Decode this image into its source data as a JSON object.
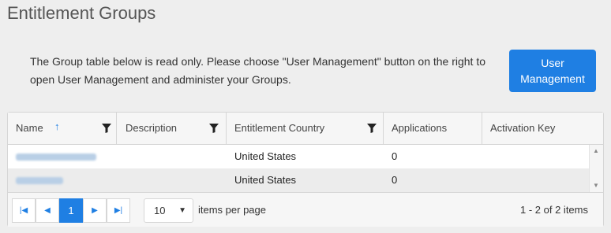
{
  "page": {
    "title": "Entitlement Groups"
  },
  "info": {
    "text": "The Group table below is read only. Please choose \"User Management\" button on the right to open User Management and administer your Groups.",
    "button_label": "User Management"
  },
  "grid": {
    "columns": [
      {
        "label": "Name",
        "sortable_icon": "sort-ascending-icon",
        "filter_icon": "filter-icon"
      },
      {
        "label": "Description",
        "filter_icon": "filter-icon"
      },
      {
        "label": "Entitlement Country",
        "filter_icon": "filter-icon"
      },
      {
        "label": "Applications"
      },
      {
        "label": "Activation Key"
      }
    ],
    "rows": [
      {
        "name": "",
        "description": "",
        "country": "United States",
        "applications": "0",
        "activation_key": ""
      },
      {
        "name": "",
        "description": "",
        "country": "United States",
        "applications": "0",
        "activation_key": ""
      }
    ]
  },
  "pager": {
    "first_icon": "first-page-icon",
    "prev_icon": "previous-page-icon",
    "current_page": "1",
    "next_icon": "next-page-icon",
    "last_icon": "last-page-icon",
    "page_size": "10",
    "items_per_page_label": "items per page",
    "info": "1 - 2 of 2 items"
  },
  "colors": {
    "accent": "#1f7fe3",
    "header_bg": "#f6f6f6",
    "page_bg": "#eeeeee"
  }
}
